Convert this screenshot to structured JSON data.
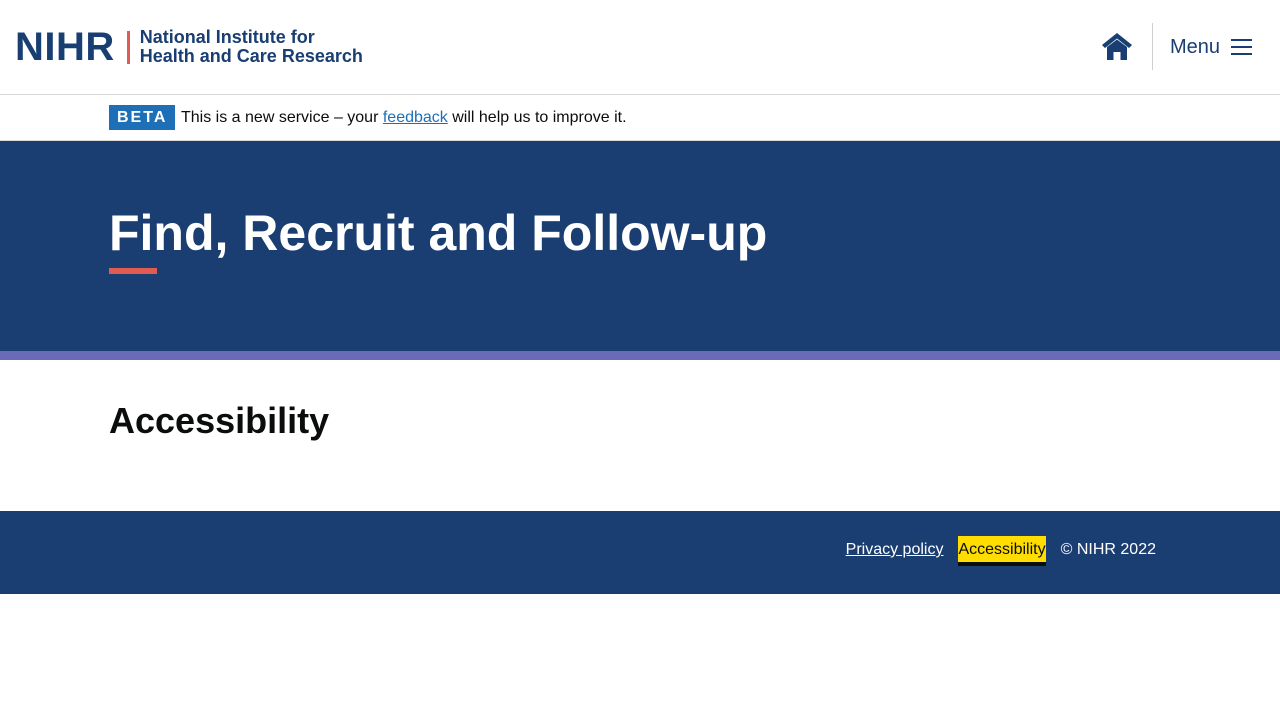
{
  "header": {
    "logo": {
      "mark": "NIHR",
      "line1": "National Institute for",
      "line2": "Health and Care Research"
    },
    "home_icon": "home-icon",
    "menu_label": "Menu",
    "menu_icon": "hamburger-icon"
  },
  "beta": {
    "tag": "BETA",
    "text_before": "This is a new service – your ",
    "link_text": "feedback",
    "text_after": " will help us to improve it."
  },
  "hero": {
    "title": "Find, Recruit and Follow-up"
  },
  "main": {
    "heading": "Accessibility"
  },
  "footer": {
    "links": [
      "Privacy policy",
      "Accessibility"
    ],
    "copyright": "© NIHR 2022"
  },
  "colors": {
    "brand_navy": "#1b3e72",
    "accent_coral": "#e05c51",
    "stripe_purple": "#6a6bb7",
    "link_blue": "#1d70b8",
    "focus_yellow": "#ffdd00"
  }
}
